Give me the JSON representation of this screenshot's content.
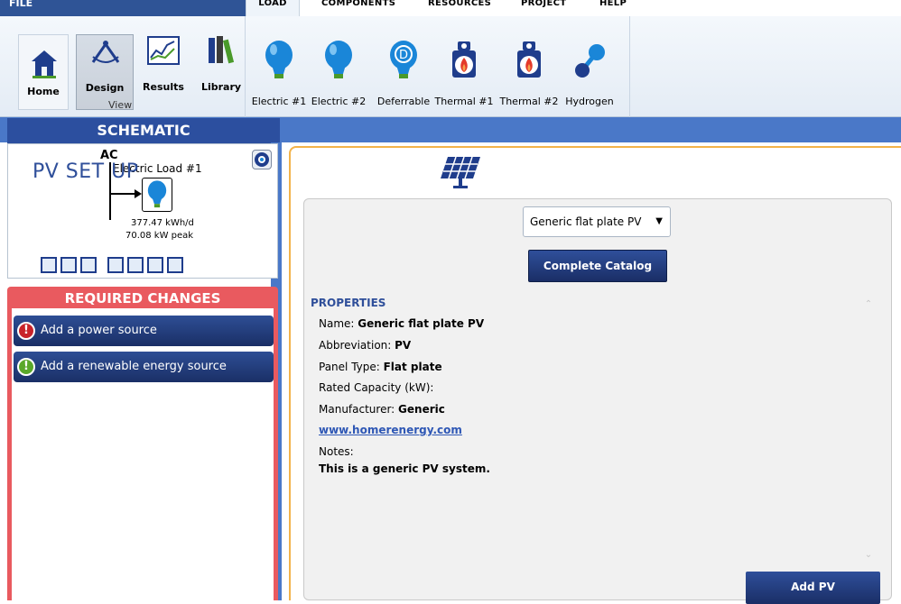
{
  "menu": {
    "file": "FILE",
    "tabs": [
      "LOAD",
      "COMPONENTS",
      "RESOURCES",
      "PROJECT",
      "HELP"
    ]
  },
  "ribbon": {
    "view_buttons": [
      {
        "label": "Home",
        "icon": "home-icon"
      },
      {
        "label": "Design",
        "icon": "design-icon"
      },
      {
        "label": "Results",
        "icon": "results-chart-icon"
      },
      {
        "label": "Library",
        "icon": "library-books-icon"
      }
    ],
    "view_group_label": "View",
    "load_buttons": [
      {
        "label": "Electric #1",
        "icon": "bulb-icon"
      },
      {
        "label": "Electric #2",
        "icon": "bulb-icon"
      },
      {
        "label": "Deferrable",
        "icon": "deferrable-bulb-icon"
      },
      {
        "label": "Thermal #1",
        "icon": "thermal-flame-icon"
      },
      {
        "label": "Thermal #2",
        "icon": "thermal-flame-icon"
      },
      {
        "label": "Hydrogen",
        "icon": "hydrogen-molecule-icon"
      }
    ]
  },
  "schematic": {
    "title": "SCHEMATIC",
    "bus": "AC",
    "load_name": "Electric Load #1",
    "load_kwh": "377.47 kWh/d",
    "load_peak": "70.08 kW peak"
  },
  "required_changes": {
    "title": "REQUIRED CHANGES",
    "items": [
      {
        "label": "Add a power source",
        "badge": "!",
        "severity": "error"
      },
      {
        "label": "Add a renewable energy source",
        "badge": "!",
        "severity": "warning"
      }
    ]
  },
  "pv": {
    "title": "PV SET UP",
    "selected": "Generic flat plate PV",
    "catalog_button": "Complete Catalog",
    "properties_title": "PROPERTIES",
    "name_label": "Name: ",
    "name_value": "Generic flat plate PV",
    "abbrev_label": "Abbreviation: ",
    "abbrev_value": "PV",
    "panel_label": "Panel Type: ",
    "panel_value": "Flat plate",
    "capacity_label": "Rated Capacity (kW):",
    "manufacturer_label": "Manufacturer: ",
    "manufacturer_value": "Generic",
    "link": "www.homerenergy.com",
    "notes_label": "Notes:",
    "notes_value": "This is a generic PV system.",
    "add_button": "Add PV"
  },
  "colors": {
    "navy": "#2f4f9a",
    "band_blue": "#4a78c8",
    "alert_red": "#e95a5f",
    "accent_orange": "#f3b34a"
  }
}
